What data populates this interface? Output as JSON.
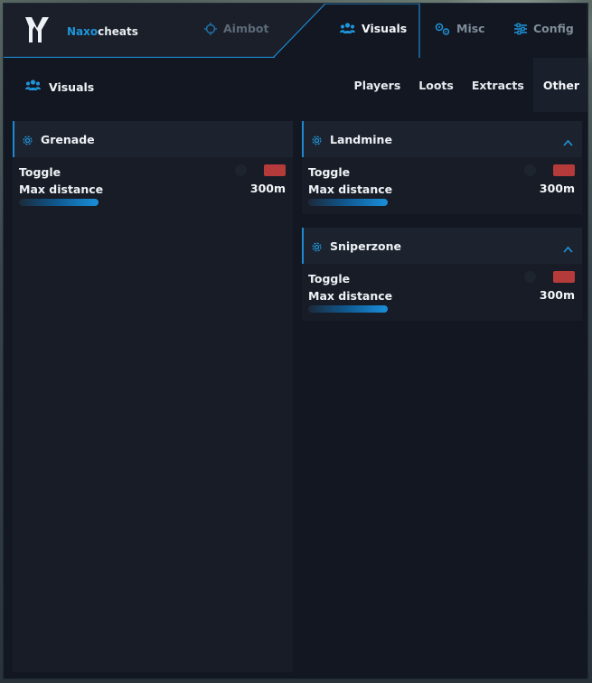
{
  "brand": {
    "accent": "Naxo",
    "rest": "cheats"
  },
  "tabs": [
    {
      "label": "Aimbot",
      "icon": "crosshair-icon"
    },
    {
      "label": "Visuals",
      "icon": "users-icon"
    },
    {
      "label": "Misc",
      "icon": "cogs-icon"
    },
    {
      "label": "Config",
      "icon": "sliders-icon"
    }
  ],
  "subheader": {
    "title": "Visuals",
    "icon": "users-icon"
  },
  "subnav": [
    "Players",
    "Loots",
    "Extracts",
    "Other"
  ],
  "subnav_selected": "Other",
  "panels": [
    {
      "title": "Grenade",
      "toggle_label": "Toggle",
      "toggle_on": false,
      "toggle_color": "#b53a3a",
      "distance_label": "Max distance",
      "distance_value": "300m",
      "slider_fraction": 0.29
    },
    {
      "title": "Landmine",
      "toggle_label": "Toggle",
      "toggle_on": false,
      "toggle_color": "#b53a3a",
      "distance_label": "Max distance",
      "distance_value": "300m",
      "slider_fraction": 0.29,
      "collapse_icon": "chevron-up-icon"
    },
    {
      "title": "Sniperzone",
      "toggle_label": "Toggle",
      "toggle_on": false,
      "toggle_color": "#b53a3a",
      "distance_label": "Max distance",
      "distance_value": "300m",
      "slider_fraction": 0.29,
      "collapse_icon": "chevron-up-icon"
    }
  ],
  "colors": {
    "accent": "#1e95db",
    "window_bg": "#121721",
    "panel_bg": "#171c26"
  }
}
